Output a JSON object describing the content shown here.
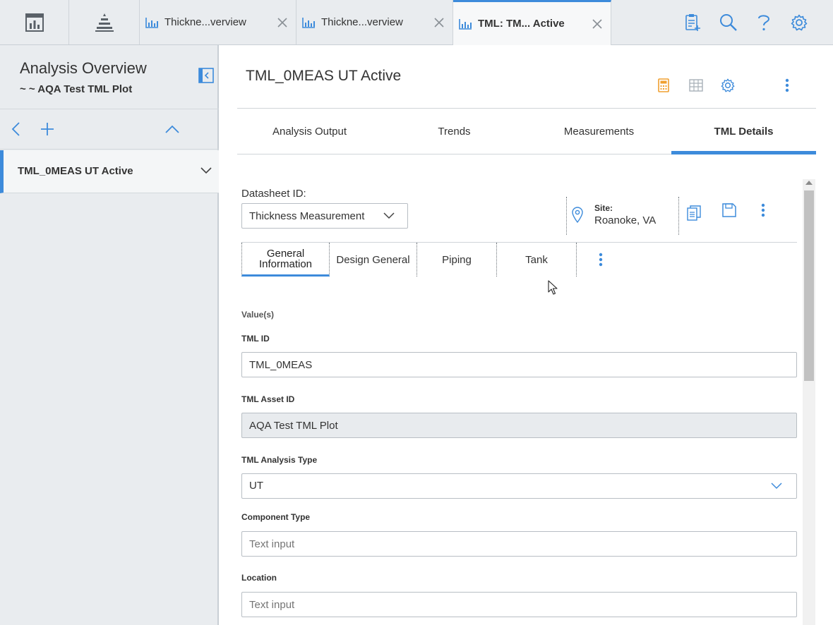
{
  "topbar": {
    "tabs": [
      {
        "label": "Thickne...verview"
      },
      {
        "label": "Thickne...verview"
      },
      {
        "label": "TML: TM... Active"
      }
    ]
  },
  "left_panel": {
    "title": "Analysis Overview",
    "subtitle": "~ ~ AQA Test TML Plot",
    "items": [
      {
        "label": "TML_0MEAS UT Active"
      }
    ]
  },
  "main": {
    "title": "TML_0MEAS UT Active",
    "tabs": [
      {
        "label": "Analysis Output"
      },
      {
        "label": "Trends"
      },
      {
        "label": "Measurements"
      },
      {
        "label": "TML Details"
      }
    ],
    "active_tab": "TML Details"
  },
  "datasheet": {
    "label": "Datasheet ID:",
    "selected": "Thickness Measurement",
    "site_label": "Site:",
    "site_value": "Roanoke, VA",
    "sub_tabs": [
      {
        "label": "General Information"
      },
      {
        "label": "Design General"
      },
      {
        "label": "Piping"
      },
      {
        "label": "Tank"
      }
    ]
  },
  "form": {
    "section": "Value(s)",
    "fields": [
      {
        "label": "TML ID",
        "value": "TML_0MEAS"
      },
      {
        "label": "TML Asset ID",
        "value": "AQA Test TML Plot"
      },
      {
        "label": "TML Analysis Type",
        "value": "UT"
      },
      {
        "label": "Component Type",
        "placeholder": "Text input"
      },
      {
        "label": "Location",
        "placeholder": "Text input"
      }
    ]
  },
  "colors": {
    "accent": "#3d8bdb",
    "panel_bg": "#e9ecef",
    "calculator_icon": "#f0a030"
  },
  "icons": {
    "top_left": [
      "dashboard-icon",
      "asset-hierarchy-icon"
    ],
    "tab_icon": "chart-icon",
    "utilities": [
      "clipboard-icon",
      "search-icon",
      "help-icon",
      "gear-icon"
    ],
    "main_header": [
      "calculator-icon",
      "table-icon",
      "gear-icon",
      "more-vertical-icon"
    ],
    "datasheet_actions": [
      "copy-icon",
      "save-icon",
      "more-vertical-icon"
    ]
  }
}
